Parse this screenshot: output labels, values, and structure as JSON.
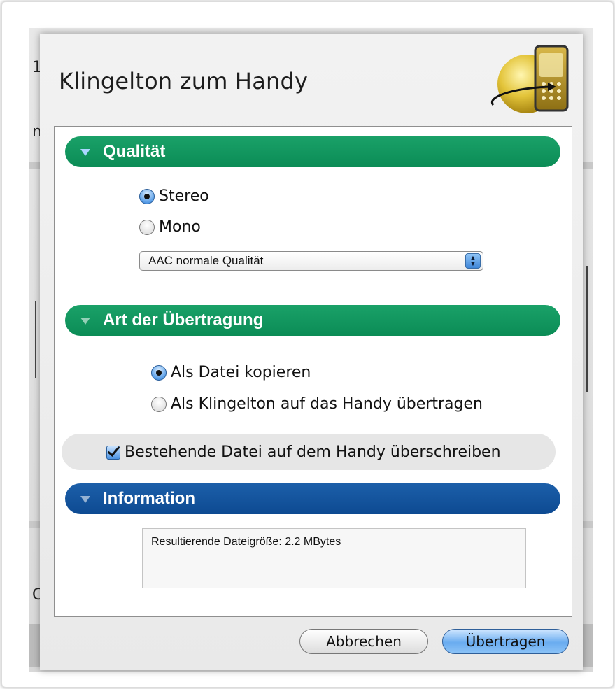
{
  "background": {
    "left_texts": [
      "1",
      "n",
      "C"
    ]
  },
  "dialog": {
    "title": "Klingelton zum Handy",
    "logo_icon": "phone-globe-icon"
  },
  "quality": {
    "header": "Qualität",
    "options": [
      "Stereo",
      "Mono"
    ],
    "selected": "Stereo",
    "format_select": "AAC normale Qualität"
  },
  "transfer": {
    "header": "Art der Übertragung",
    "options": [
      "Als Datei kopieren",
      "Als Klingelton auf das Handy übertragen"
    ],
    "selected": "Als Datei kopieren"
  },
  "overwrite": {
    "label": "Bestehende Datei auf dem Handy überschreiben",
    "checked": true
  },
  "information": {
    "header": "Information",
    "text": "Resultierende Dateigröße: 2.2 MBytes"
  },
  "buttons": {
    "cancel": "Abbrechen",
    "ok": "Übertragen"
  },
  "colors": {
    "section_green": "#0f955c",
    "section_blue": "#114f96",
    "accent_blue": "#5a9fe8"
  }
}
